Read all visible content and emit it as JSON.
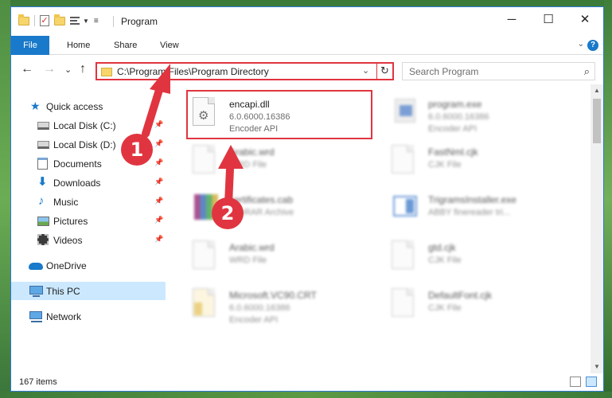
{
  "window": {
    "title": "Program",
    "minimize_glyph": "─",
    "maximize_glyph": "☐",
    "close_glyph": "✕"
  },
  "ribbon": {
    "tabs": [
      "File",
      "Home",
      "Share",
      "View"
    ],
    "collapse_glyph": "⌄",
    "help_glyph": "?"
  },
  "nav": {
    "back_glyph": "←",
    "forward_glyph": "→",
    "recent_glyph": "⌄",
    "up_glyph": "↑"
  },
  "address": {
    "path": "C:\\Program Files\\Program Directory",
    "dropdown_glyph": "⌄",
    "refresh_glyph": "↻"
  },
  "search": {
    "placeholder": "Search Program",
    "icon_glyph": "⌕"
  },
  "sidebar": {
    "items": [
      {
        "label": "Quick access",
        "icon": "star-icon",
        "pinned": false
      },
      {
        "label": "Local Disk (C:)",
        "icon": "disk-icon",
        "pinned": true
      },
      {
        "label": "Local Disk (D:)",
        "icon": "disk-icon",
        "pinned": true
      },
      {
        "label": "Documents",
        "icon": "documents-icon",
        "pinned": true
      },
      {
        "label": "Downloads",
        "icon": "download-icon",
        "pinned": true
      },
      {
        "label": "Music",
        "icon": "music-icon",
        "pinned": true
      },
      {
        "label": "Pictures",
        "icon": "pictures-icon",
        "pinned": true
      },
      {
        "label": "Videos",
        "icon": "videos-icon",
        "pinned": true
      },
      {
        "label": "OneDrive",
        "icon": "cloud-icon",
        "pinned": false
      },
      {
        "label": "This PC",
        "icon": "computer-icon",
        "pinned": false,
        "selected": true
      },
      {
        "label": "Network",
        "icon": "network-icon",
        "pinned": false
      }
    ]
  },
  "files": [
    {
      "name": "encapi.dll",
      "line2": "6.0.6000.16386",
      "line3": "Encoder API",
      "icon": "dll-gear-icon",
      "highlighted": true
    },
    {
      "name": "program.exe",
      "line2": "6.0.6000.16386",
      "line3": "Encoder API",
      "icon": "exe-icon"
    },
    {
      "name": "Arabic.wrd",
      "line2": "WRD File",
      "line3": "",
      "icon": "file-icon"
    },
    {
      "name": "FastNml.cjk",
      "line2": "CJK File",
      "line3": "",
      "icon": "file-icon"
    },
    {
      "name": "certificates.cab",
      "line2": "WinRAR Archive",
      "line3": "",
      "icon": "winrar-icon"
    },
    {
      "name": "TrigramsInstaller.exe",
      "line2": "ABBY finereader tri...",
      "line3": "",
      "icon": "installer-icon"
    },
    {
      "name": "Arabic.wrd",
      "line2": "WRD File",
      "line3": "",
      "icon": "file-icon"
    },
    {
      "name": "gtd.cjk",
      "line2": "CJK File",
      "line3": "",
      "icon": "file-icon"
    },
    {
      "name": "Microsoft.VC90.CRT",
      "line2": "6.0.6000.16386",
      "line3": "Encoder API",
      "icon": "folder-doc-icon"
    },
    {
      "name": "DefaultFont.cjk",
      "line2": "CJK File",
      "line3": "",
      "icon": "file-icon"
    }
  ],
  "status": {
    "item_count": "167 items"
  },
  "annotations": {
    "badge_1": "1",
    "badge_2": "2",
    "color": "#e03540"
  },
  "colors": {
    "accent": "#1979ca",
    "selection": "#cce8ff",
    "highlight": "#e03540"
  }
}
